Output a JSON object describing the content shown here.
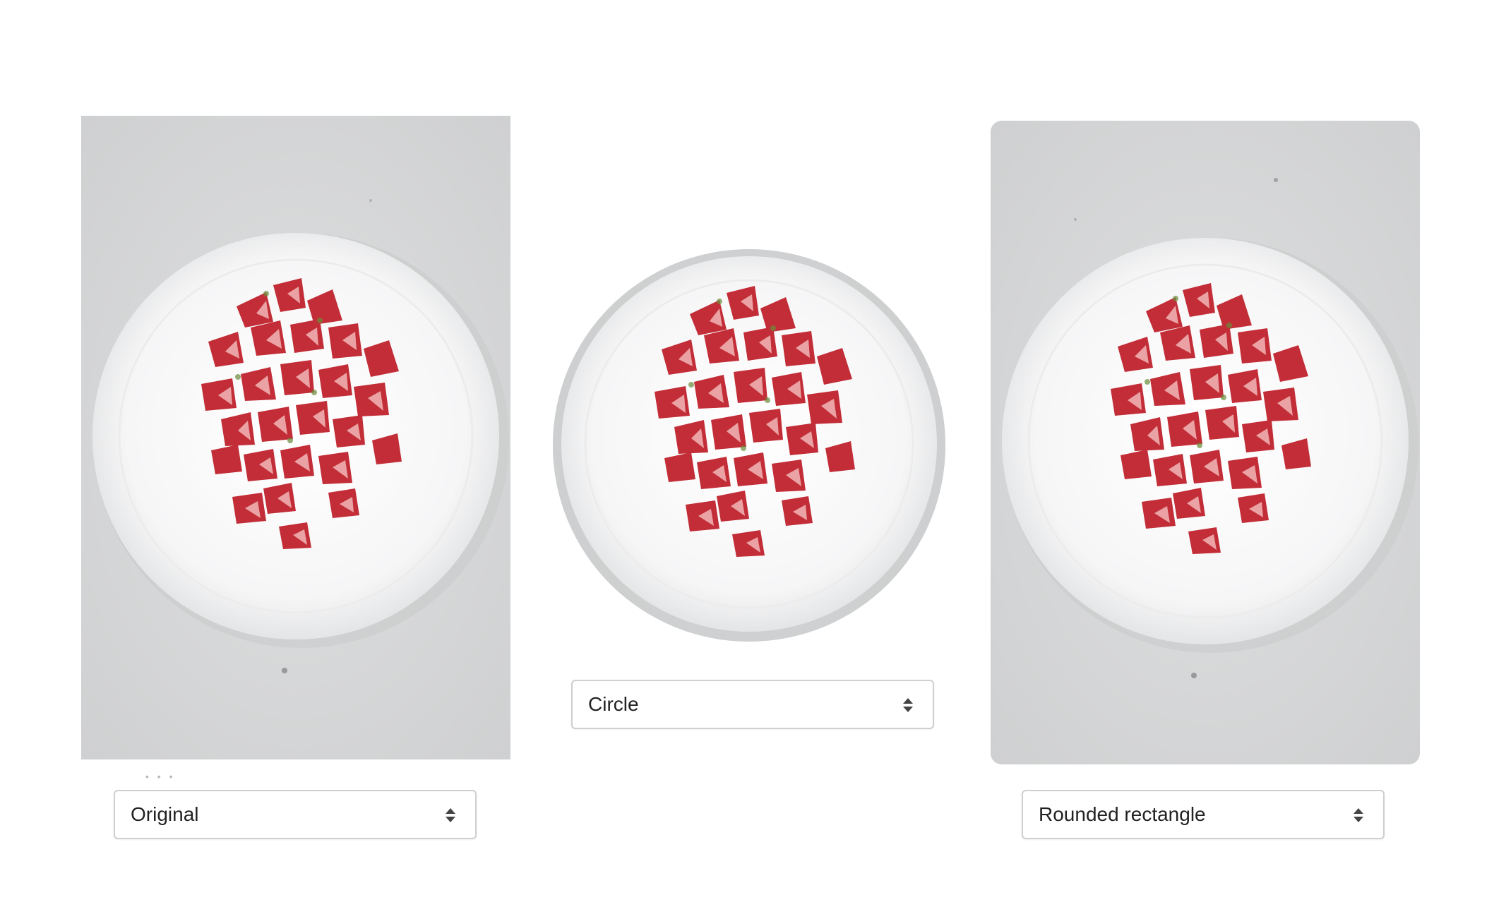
{
  "panels": [
    {
      "id": "original",
      "shape": "Original"
    },
    {
      "id": "circle",
      "shape": "Circle"
    },
    {
      "id": "rounded",
      "shape": "Rounded rectangle"
    }
  ],
  "selects": {
    "original": {
      "value": "Original",
      "icon": "up-down-chevron-icon"
    },
    "circle": {
      "value": "Circle",
      "icon": "up-down-chevron-icon"
    },
    "rounded": {
      "value": "Rounded rectangle",
      "icon": "up-down-chevron-icon"
    }
  },
  "image": {
    "subject": "bowl-of-strawberries-photo",
    "background_color": "#d9dadb",
    "bowl_color": "#f7f7f7",
    "fruit_color": "#c9303a"
  }
}
